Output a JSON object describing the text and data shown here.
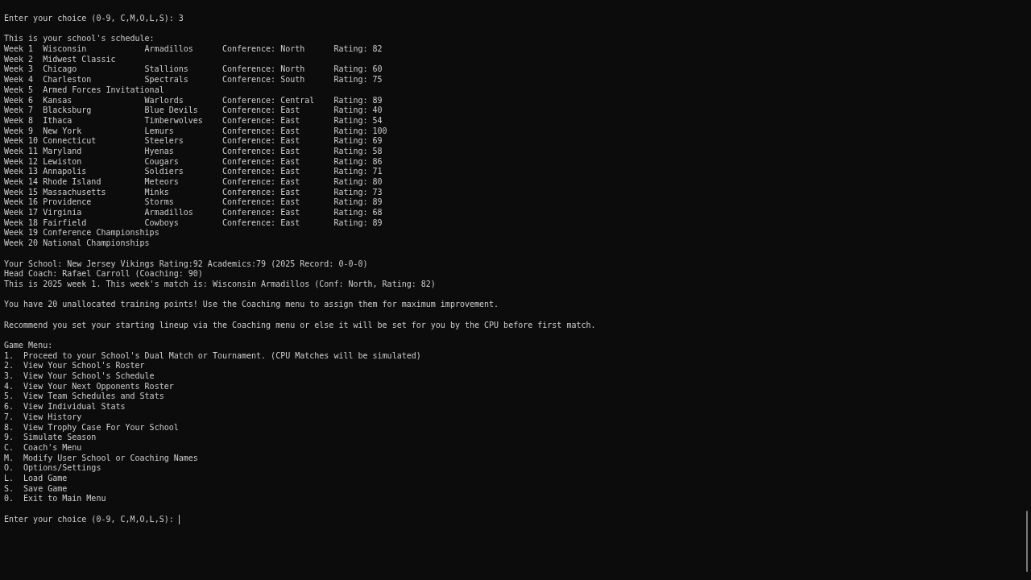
{
  "prompt_top": {
    "label": "Enter your choice (0-9, C,M,O,L,S):",
    "value": "3"
  },
  "schedule_heading": "This is your school's schedule:",
  "schedule": [
    {
      "kind": "match",
      "week": "Week 1",
      "school": "Wisconsin",
      "mascot": "Armadillos",
      "conference": "Conference: North",
      "rating": "Rating: 82"
    },
    {
      "kind": "event",
      "week": "Week 2",
      "event": "Midwest Classic"
    },
    {
      "kind": "match",
      "week": "Week 3",
      "school": "Chicago",
      "mascot": "Stallions",
      "conference": "Conference: North",
      "rating": "Rating: 60"
    },
    {
      "kind": "match",
      "week": "Week 4",
      "school": "Charleston",
      "mascot": "Spectrals",
      "conference": "Conference: South",
      "rating": "Rating: 75"
    },
    {
      "kind": "event",
      "week": "Week 5",
      "event": "Armed Forces Invitational"
    },
    {
      "kind": "match",
      "week": "Week 6",
      "school": "Kansas",
      "mascot": "Warlords",
      "conference": "Conference: Central",
      "rating": "Rating: 89"
    },
    {
      "kind": "match",
      "week": "Week 7",
      "school": "Blacksburg",
      "mascot": "Blue Devils",
      "conference": "Conference: East",
      "rating": "Rating: 40"
    },
    {
      "kind": "match",
      "week": "Week 8",
      "school": "Ithaca",
      "mascot": "Timberwolves",
      "conference": "Conference: East",
      "rating": "Rating: 54"
    },
    {
      "kind": "match",
      "week": "Week 9",
      "school": "New York",
      "mascot": "Lemurs",
      "conference": "Conference: East",
      "rating": "Rating: 100"
    },
    {
      "kind": "match",
      "week": "Week 10",
      "school": "Connecticut",
      "mascot": "Steelers",
      "conference": "Conference: East",
      "rating": "Rating: 69"
    },
    {
      "kind": "match",
      "week": "Week 11",
      "school": "Maryland",
      "mascot": "Hyenas",
      "conference": "Conference: East",
      "rating": "Rating: 58"
    },
    {
      "kind": "match",
      "week": "Week 12",
      "school": "Lewiston",
      "mascot": "Cougars",
      "conference": "Conference: East",
      "rating": "Rating: 86"
    },
    {
      "kind": "match",
      "week": "Week 13",
      "school": "Annapolis",
      "mascot": "Soldiers",
      "conference": "Conference: East",
      "rating": "Rating: 71"
    },
    {
      "kind": "match",
      "week": "Week 14",
      "school": "Rhode Island",
      "mascot": "Meteors",
      "conference": "Conference: East",
      "rating": "Rating: 80"
    },
    {
      "kind": "match",
      "week": "Week 15",
      "school": "Massachusetts",
      "mascot": "Minks",
      "conference": "Conference: East",
      "rating": "Rating: 73"
    },
    {
      "kind": "match",
      "week": "Week 16",
      "school": "Providence",
      "mascot": "Storms",
      "conference": "Conference: East",
      "rating": "Rating: 89"
    },
    {
      "kind": "match",
      "week": "Week 17",
      "school": "Virginia",
      "mascot": "Armadillos",
      "conference": "Conference: East",
      "rating": "Rating: 68"
    },
    {
      "kind": "match",
      "week": "Week 18",
      "school": "Fairfield",
      "mascot": "Cowboys",
      "conference": "Conference: East",
      "rating": "Rating: 89"
    },
    {
      "kind": "event",
      "week": "Week 19",
      "event": "Conference Championships"
    },
    {
      "kind": "event",
      "week": "Week 20",
      "event": "National Championships"
    }
  ],
  "info_lines": [
    "Your School: New Jersey Vikings Rating:92 Academics:79 (2025 Record: 0-0-0)",
    "Head Coach: Rafael Carroll (Coaching: 90)",
    "This is 2025 week 1. This week's match is: Wisconsin Armadillos (Conf: North, Rating: 82)"
  ],
  "notices": [
    "You have 20 unallocated training points! Use the Coaching menu to assign them for maximum improvement.",
    "Recommend you set your starting lineup via the Coaching menu or else it will be set for you by the CPU before first match."
  ],
  "menu_title": "Game Menu:",
  "menu_items": [
    {
      "key": "1.",
      "label": "Proceed to your School's Dual Match or Tournament. (CPU Matches will be simulated)"
    },
    {
      "key": "2.",
      "label": "View Your School's Roster"
    },
    {
      "key": "3.",
      "label": "View Your School's Schedule"
    },
    {
      "key": "4.",
      "label": "View Your Next Opponents Roster"
    },
    {
      "key": "5.",
      "label": "View Team Schedules and Stats"
    },
    {
      "key": "6.",
      "label": "View Individual Stats"
    },
    {
      "key": "7.",
      "label": "View History"
    },
    {
      "key": "8.",
      "label": "View Trophy Case For Your School"
    },
    {
      "key": "9.",
      "label": "Simulate Season"
    },
    {
      "key": "C.",
      "label": "Coach's Menu"
    },
    {
      "key": "M.",
      "label": "Modify User School or Coaching Names"
    },
    {
      "key": "O.",
      "label": "Options/Settings"
    },
    {
      "key": "L.",
      "label": "Load Game"
    },
    {
      "key": "S.",
      "label": "Save Game"
    },
    {
      "key": "0.",
      "label": "Exit to Main Menu"
    }
  ],
  "prompt_bottom": {
    "label": "Enter your choice (0-9, C,M,O,L,S):"
  }
}
